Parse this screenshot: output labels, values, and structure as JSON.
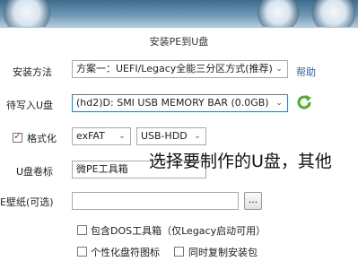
{
  "window": {
    "title": "安装PE到U盘"
  },
  "install_method": {
    "label": "安装方法",
    "value": "方案一：UEFI/Legacy全能三分区方式(推荐)",
    "help_link": "帮助"
  },
  "target_disk": {
    "label": "待写入U盘",
    "value": "(hd2)D: SMI USB MEMORY BAR (0.0GB)"
  },
  "format": {
    "checkbox_label": "格式化",
    "checked": true,
    "filesystem": "exFAT",
    "mode": "USB-HDD"
  },
  "volume_label": {
    "label": "U盘卷标",
    "value": "微PE工具箱"
  },
  "wallpaper": {
    "label": "E壁纸(可选)",
    "value": "",
    "browse_label": "..."
  },
  "options": {
    "include_dos": "包含DOS工具箱（仅Legacy启动可用）",
    "personalize_icon": "个性化盘符图标",
    "sync_copy": "同时复制安装包"
  },
  "subtitle_overlay": "选择要制作的U盘，其他"
}
